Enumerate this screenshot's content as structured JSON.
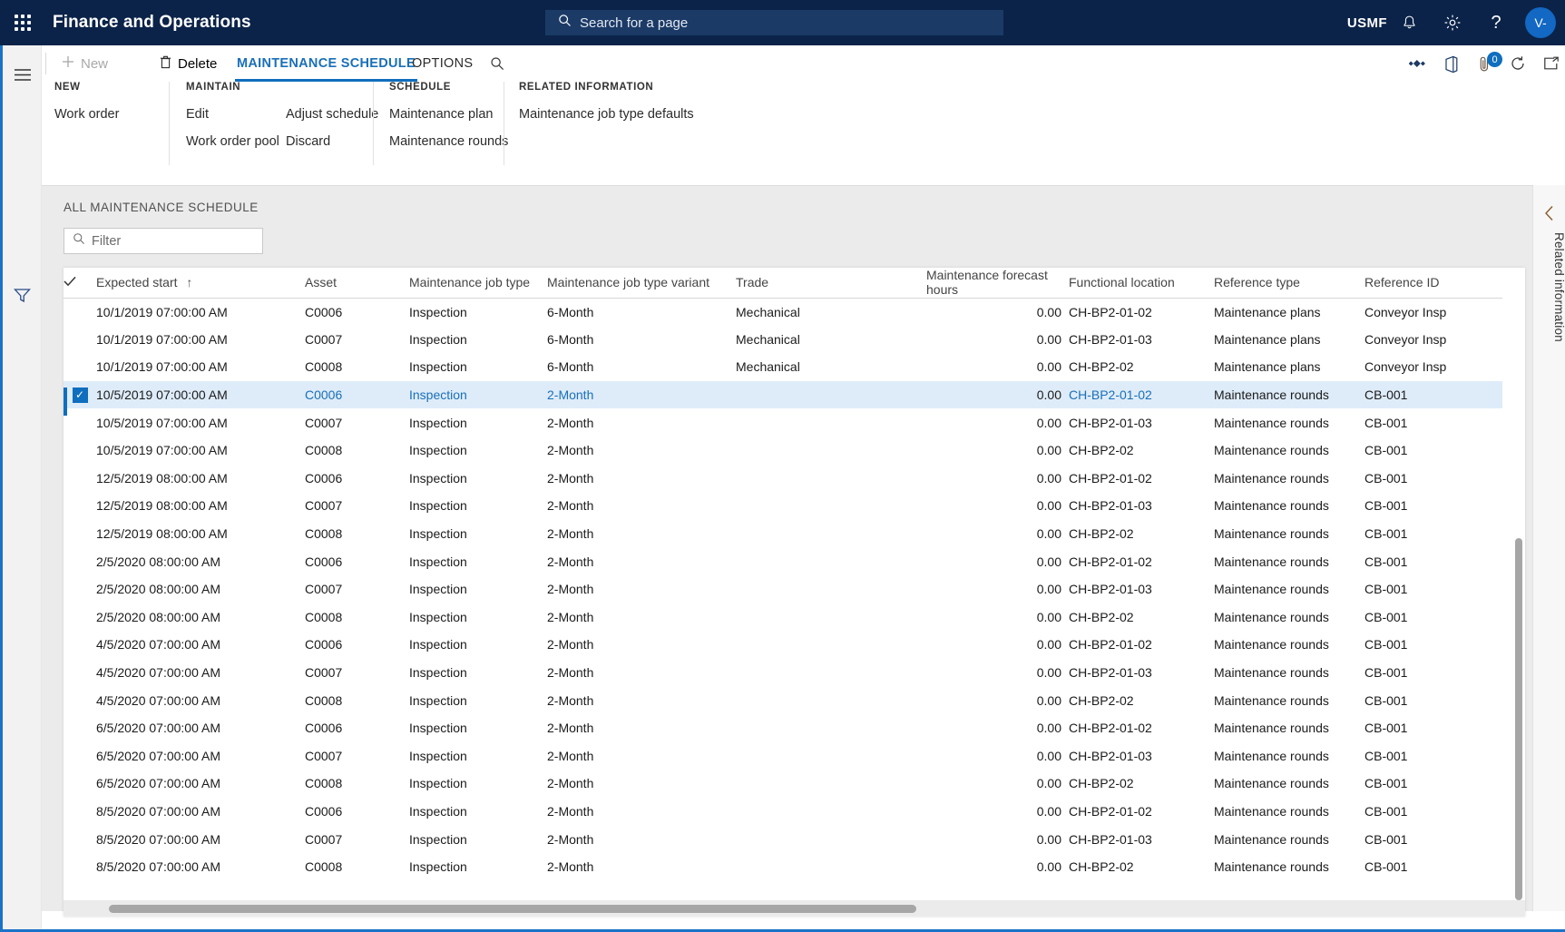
{
  "topbar": {
    "waffle_icon": "app-launcher-icon",
    "app_title": "Finance and Operations",
    "search": {
      "icon": "search-icon",
      "placeholder": "Search for a page",
      "value": ""
    },
    "company": "USMF",
    "notifications_icon": "bell-icon",
    "settings_icon": "gear-icon",
    "help_icon": "question-icon",
    "avatar_initials": "V-"
  },
  "leftrail": {
    "menu_icon": "hamburger-menu-icon",
    "filter_icon": "filter-funnel-icon"
  },
  "commandbar": {
    "new_label": "New",
    "new_icon": "plus-icon",
    "delete_label": "Delete",
    "delete_icon": "trash-icon",
    "tab_maintenance_schedule": "MAINTENANCE SCHEDULE",
    "tab_options": "OPTIONS",
    "search_icon": "search-icon",
    "right_icons": {
      "relationships": "relationships-icon",
      "office": "office-export-icon",
      "attachments": "attachment-icon",
      "attachments_badge": "0",
      "refresh": "refresh-icon",
      "popout": "open-in-new-window-icon",
      "close": "close-icon"
    }
  },
  "ribbon": {
    "groups": [
      {
        "title": "NEW",
        "items": [
          "Work order"
        ]
      },
      {
        "title": "MAINTAIN",
        "items": [
          "Edit",
          "Work order pool",
          "Adjust schedule",
          "Discard"
        ]
      },
      {
        "title": "SCHEDULE",
        "items": [
          "Maintenance plan",
          "Maintenance rounds"
        ]
      },
      {
        "title": "RELATED INFORMATION",
        "items": [
          "Maintenance job type defaults"
        ]
      }
    ]
  },
  "grid": {
    "caption": "ALL MAINTENANCE SCHEDULE",
    "filter": {
      "icon": "search-icon",
      "placeholder": "Filter",
      "value": ""
    },
    "sort_indicator": "↑",
    "select_all_icon": "checkmark-icon",
    "columns": [
      "Expected start",
      "Asset",
      "Maintenance job type",
      "Maintenance job type variant",
      "Trade",
      "Maintenance forecast hours",
      "Functional location",
      "Reference type",
      "Reference ID"
    ],
    "rows": [
      {
        "selected": false,
        "expected_start": "10/1/2019 07:00:00 AM",
        "asset": "C0006",
        "job_type": "Inspection",
        "variant": "6-Month",
        "trade": "Mechanical",
        "hours": "0.00",
        "location": "CH-BP2-01-02",
        "ref_type": "Maintenance plans",
        "ref_id": "Conveyor Insp"
      },
      {
        "selected": false,
        "expected_start": "10/1/2019 07:00:00 AM",
        "asset": "C0007",
        "job_type": "Inspection",
        "variant": "6-Month",
        "trade": "Mechanical",
        "hours": "0.00",
        "location": "CH-BP2-01-03",
        "ref_type": "Maintenance plans",
        "ref_id": "Conveyor Insp"
      },
      {
        "selected": false,
        "expected_start": "10/1/2019 07:00:00 AM",
        "asset": "C0008",
        "job_type": "Inspection",
        "variant": "6-Month",
        "trade": "Mechanical",
        "hours": "0.00",
        "location": "CH-BP2-02",
        "ref_type": "Maintenance plans",
        "ref_id": "Conveyor Insp"
      },
      {
        "selected": true,
        "expected_start": "10/5/2019 07:00:00 AM",
        "asset": "C0006",
        "job_type": "Inspection",
        "variant": "2-Month",
        "trade": "",
        "hours": "0.00",
        "location": "CH-BP2-01-02",
        "ref_type": "Maintenance rounds",
        "ref_id": "CB-001"
      },
      {
        "selected": false,
        "expected_start": "10/5/2019 07:00:00 AM",
        "asset": "C0007",
        "job_type": "Inspection",
        "variant": "2-Month",
        "trade": "",
        "hours": "0.00",
        "location": "CH-BP2-01-03",
        "ref_type": "Maintenance rounds",
        "ref_id": "CB-001"
      },
      {
        "selected": false,
        "expected_start": "10/5/2019 07:00:00 AM",
        "asset": "C0008",
        "job_type": "Inspection",
        "variant": "2-Month",
        "trade": "",
        "hours": "0.00",
        "location": "CH-BP2-02",
        "ref_type": "Maintenance rounds",
        "ref_id": "CB-001"
      },
      {
        "selected": false,
        "expected_start": "12/5/2019 08:00:00 AM",
        "asset": "C0006",
        "job_type": "Inspection",
        "variant": "2-Month",
        "trade": "",
        "hours": "0.00",
        "location": "CH-BP2-01-02",
        "ref_type": "Maintenance rounds",
        "ref_id": "CB-001"
      },
      {
        "selected": false,
        "expected_start": "12/5/2019 08:00:00 AM",
        "asset": "C0007",
        "job_type": "Inspection",
        "variant": "2-Month",
        "trade": "",
        "hours": "0.00",
        "location": "CH-BP2-01-03",
        "ref_type": "Maintenance rounds",
        "ref_id": "CB-001"
      },
      {
        "selected": false,
        "expected_start": "12/5/2019 08:00:00 AM",
        "asset": "C0008",
        "job_type": "Inspection",
        "variant": "2-Month",
        "trade": "",
        "hours": "0.00",
        "location": "CH-BP2-02",
        "ref_type": "Maintenance rounds",
        "ref_id": "CB-001"
      },
      {
        "selected": false,
        "expected_start": "2/5/2020 08:00:00 AM",
        "asset": "C0006",
        "job_type": "Inspection",
        "variant": "2-Month",
        "trade": "",
        "hours": "0.00",
        "location": "CH-BP2-01-02",
        "ref_type": "Maintenance rounds",
        "ref_id": "CB-001"
      },
      {
        "selected": false,
        "expected_start": "2/5/2020 08:00:00 AM",
        "asset": "C0007",
        "job_type": "Inspection",
        "variant": "2-Month",
        "trade": "",
        "hours": "0.00",
        "location": "CH-BP2-01-03",
        "ref_type": "Maintenance rounds",
        "ref_id": "CB-001"
      },
      {
        "selected": false,
        "expected_start": "2/5/2020 08:00:00 AM",
        "asset": "C0008",
        "job_type": "Inspection",
        "variant": "2-Month",
        "trade": "",
        "hours": "0.00",
        "location": "CH-BP2-02",
        "ref_type": "Maintenance rounds",
        "ref_id": "CB-001"
      },
      {
        "selected": false,
        "expected_start": "4/5/2020 07:00:00 AM",
        "asset": "C0006",
        "job_type": "Inspection",
        "variant": "2-Month",
        "trade": "",
        "hours": "0.00",
        "location": "CH-BP2-01-02",
        "ref_type": "Maintenance rounds",
        "ref_id": "CB-001"
      },
      {
        "selected": false,
        "expected_start": "4/5/2020 07:00:00 AM",
        "asset": "C0007",
        "job_type": "Inspection",
        "variant": "2-Month",
        "trade": "",
        "hours": "0.00",
        "location": "CH-BP2-01-03",
        "ref_type": "Maintenance rounds",
        "ref_id": "CB-001"
      },
      {
        "selected": false,
        "expected_start": "4/5/2020 07:00:00 AM",
        "asset": "C0008",
        "job_type": "Inspection",
        "variant": "2-Month",
        "trade": "",
        "hours": "0.00",
        "location": "CH-BP2-02",
        "ref_type": "Maintenance rounds",
        "ref_id": "CB-001"
      },
      {
        "selected": false,
        "expected_start": "6/5/2020 07:00:00 AM",
        "asset": "C0006",
        "job_type": "Inspection",
        "variant": "2-Month",
        "trade": "",
        "hours": "0.00",
        "location": "CH-BP2-01-02",
        "ref_type": "Maintenance rounds",
        "ref_id": "CB-001"
      },
      {
        "selected": false,
        "expected_start": "6/5/2020 07:00:00 AM",
        "asset": "C0007",
        "job_type": "Inspection",
        "variant": "2-Month",
        "trade": "",
        "hours": "0.00",
        "location": "CH-BP2-01-03",
        "ref_type": "Maintenance rounds",
        "ref_id": "CB-001"
      },
      {
        "selected": false,
        "expected_start": "6/5/2020 07:00:00 AM",
        "asset": "C0008",
        "job_type": "Inspection",
        "variant": "2-Month",
        "trade": "",
        "hours": "0.00",
        "location": "CH-BP2-02",
        "ref_type": "Maintenance rounds",
        "ref_id": "CB-001"
      },
      {
        "selected": false,
        "expected_start": "8/5/2020 07:00:00 AM",
        "asset": "C0006",
        "job_type": "Inspection",
        "variant": "2-Month",
        "trade": "",
        "hours": "0.00",
        "location": "CH-BP2-01-02",
        "ref_type": "Maintenance rounds",
        "ref_id": "CB-001"
      },
      {
        "selected": false,
        "expected_start": "8/5/2020 07:00:00 AM",
        "asset": "C0007",
        "job_type": "Inspection",
        "variant": "2-Month",
        "trade": "",
        "hours": "0.00",
        "location": "CH-BP2-01-03",
        "ref_type": "Maintenance rounds",
        "ref_id": "CB-001"
      },
      {
        "selected": false,
        "expected_start": "8/5/2020 07:00:00 AM",
        "asset": "C0008",
        "job_type": "Inspection",
        "variant": "2-Month",
        "trade": "",
        "hours": "0.00",
        "location": "CH-BP2-02",
        "ref_type": "Maintenance rounds",
        "ref_id": "CB-001"
      }
    ]
  },
  "rightrail": {
    "chevron_icon": "chevron-left-icon",
    "label": "Related information"
  },
  "colors": {
    "nav_bg": "#0b2349",
    "accent": "#106ebe",
    "link": "#1a6fb8",
    "selected_row": "#deecf9",
    "page_bg": "#ebebeb"
  }
}
